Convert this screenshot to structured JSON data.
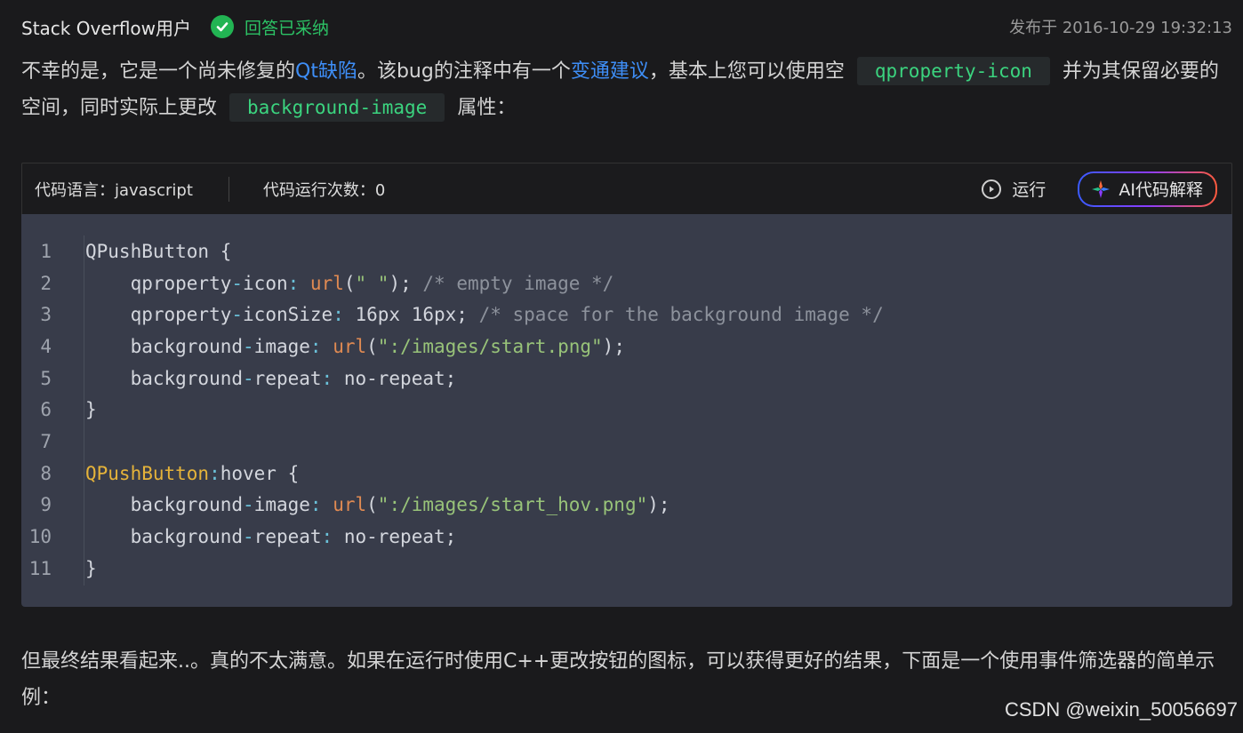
{
  "header": {
    "author": "Stack Overflow用户",
    "accepted_label": "回答已采纳",
    "pubdate": "发布于 2016-10-29 19:32:13"
  },
  "para1": {
    "t1": "不幸的是，它是一个尚未修复的",
    "link1": "Qt缺陷",
    "t2": "。该bug的注释中有一个",
    "link2": "变通建议",
    "t3": "，基本上您可以使用空",
    "code1": "qproperty-icon",
    "t4": "并为其保留必要的空间，同时实际上更改",
    "code2": "background-image",
    "t5": "属性："
  },
  "codeblock": {
    "lang_label": "代码语言：javascript",
    "run_count_label": "代码运行次数：0",
    "run_label": "运行",
    "ai_label": "AI代码解释",
    "line_numbers": [
      "1",
      "2",
      "3",
      "4",
      "5",
      "6",
      "7",
      "8",
      "9",
      "10",
      "11"
    ],
    "lines": [
      "QPushButton {",
      "    qproperty-icon: url(\" \"); /* empty image */",
      "    qproperty-iconSize: 16px 16px; /* space for the background image */",
      "    background-image: url(\":/images/start.png\");",
      "    background-repeat: no-repeat;",
      "}",
      "",
      "QPushButton:hover {",
      "    background-image: url(\":/images/start_hov.png\");",
      "    background-repeat: no-repeat;",
      "}"
    ]
  },
  "para2": {
    "text": "但最终结果看起来..。真的不太满意。如果在运行时使用C++更改按钮的图标，可以获得更好的结果，下面是一个使用事件筛选器的简单示例："
  },
  "watermark": "CSDN @weixin_50056697"
}
